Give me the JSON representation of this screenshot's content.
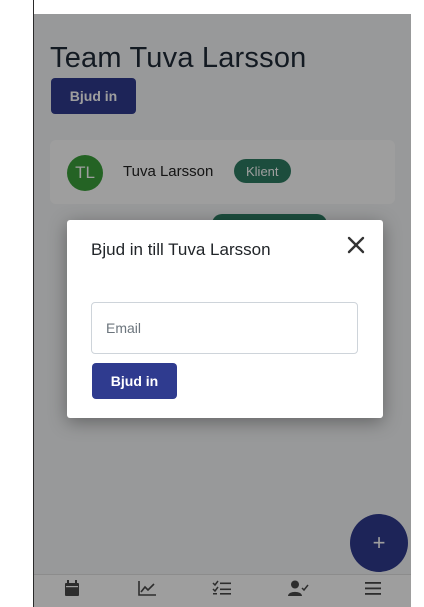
{
  "page": {
    "title": "Team Tuva Larsson",
    "invite_label": "Bjud in"
  },
  "member": {
    "initials": "TL",
    "name": "Tuva Larsson",
    "role": "Klient"
  },
  "fab": {
    "label": "+"
  },
  "nav": {
    "items": [
      {
        "icon": "calendar-icon",
        "label": ""
      },
      {
        "icon": "chart-icon",
        "label": ""
      },
      {
        "icon": "checklist-icon",
        "label": ""
      },
      {
        "icon": "user-check-icon",
        "label": ""
      },
      {
        "icon": "menu-icon",
        "label": ""
      }
    ]
  },
  "modal": {
    "title": "Bjud in till Tuva Larsson",
    "email_placeholder": "Email",
    "email_value": "",
    "submit_label": "Bjud in"
  },
  "colors": {
    "primary": "#2f3b8f",
    "badge": "#2e7d63",
    "avatar": "#3aa13a"
  }
}
